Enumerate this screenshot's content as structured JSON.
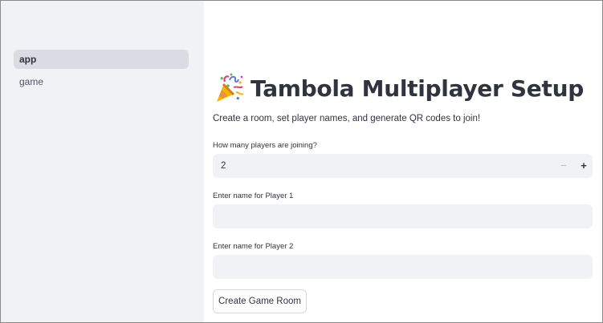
{
  "sidebar": {
    "items": [
      {
        "label": "app",
        "active": true
      },
      {
        "label": "game",
        "active": false
      }
    ]
  },
  "main": {
    "title": "Tambola Multiplayer Setup",
    "title_icon": "party-popper-icon",
    "subtitle": "Create a room, set player names, and generate QR codes to join!",
    "players_label": "How many players are joining?",
    "players_value": "2",
    "minus_label": "−",
    "plus_label": "+",
    "player1_label": "Enter name for Player 1",
    "player1_value": "",
    "player2_label": "Enter name for Player 2",
    "player2_value": "",
    "button_label": "Create Game Room"
  },
  "colors": {
    "sidebar_bg": "#f0f2f6",
    "active_nav_bg": "#d9dce3",
    "input_bg": "#f0f2f6",
    "text": "#31333f"
  }
}
